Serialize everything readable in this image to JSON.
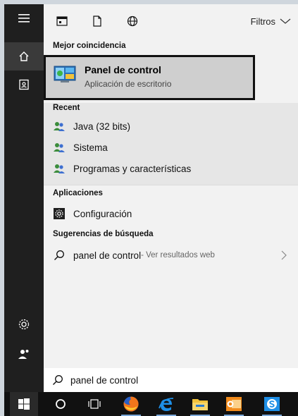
{
  "topbar": {
    "filters_label": "Filtros",
    "icons": [
      "apps-icon",
      "document-icon",
      "web-icon",
      "chevron-down-icon"
    ]
  },
  "best_match": {
    "section_title": "Mejor coincidencia",
    "title": "Panel de control",
    "subtitle": "Aplicación de escritorio",
    "icon": "control-panel-icon"
  },
  "recent": {
    "section_title": "Recent",
    "items": [
      {
        "label": "Java (32 bits)",
        "icon": "users-icon"
      },
      {
        "label": "Sistema",
        "icon": "users-icon"
      },
      {
        "label": "Programas y características",
        "icon": "users-icon"
      }
    ]
  },
  "apps": {
    "section_title": "Aplicaciones",
    "items": [
      {
        "label": "Configuración",
        "icon": "settings-icon"
      }
    ]
  },
  "suggestions": {
    "section_title": "Sugerencias de búsqueda",
    "items": [
      {
        "label": "panel de control",
        "sub": " - Ver resultados web",
        "icon": "search-icon"
      }
    ]
  },
  "search": {
    "value": "panel de control"
  },
  "rail": {
    "items": [
      "menu-icon",
      "home-icon",
      "user-card-icon",
      "gear-icon",
      "person-icon"
    ]
  },
  "taskbar": {
    "items": [
      "windows-start-icon",
      "cortana-icon",
      "task-view-icon",
      "firefox-icon",
      "internet-explorer-icon",
      "file-explorer-icon",
      "outlook-icon",
      "skype-icon"
    ]
  },
  "colors": {
    "rail_bg": "#1f1f1f",
    "panel_bg": "#f2f2f2",
    "best_highlight": "#cfcfcf",
    "taskbar_bg": "#111111",
    "accent": "#1e8fe6"
  }
}
